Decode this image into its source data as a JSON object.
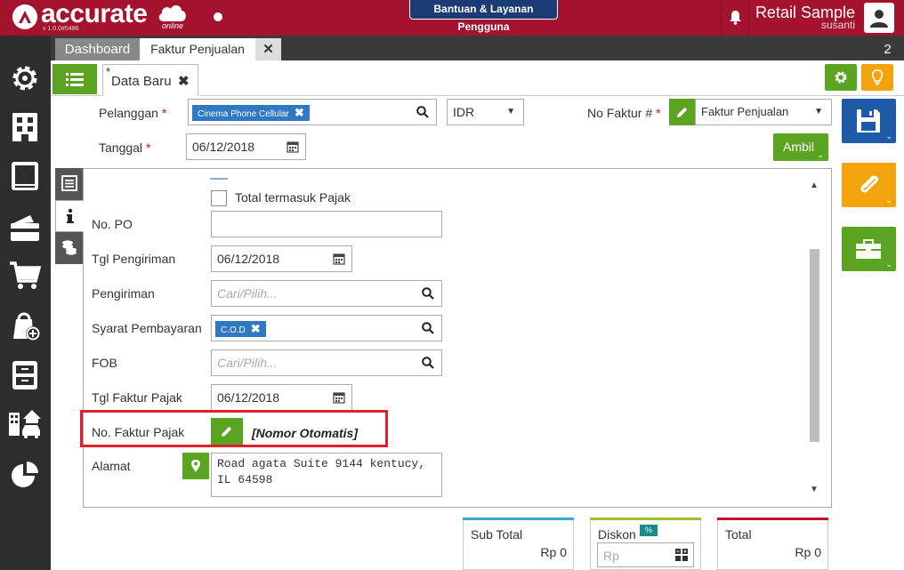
{
  "header": {
    "brand": "accurate",
    "brand_sub": "online",
    "version": "v 1.0.0#5486",
    "help_label": "Bantuan & Layanan Pengguna",
    "company": "Retail Sample",
    "user": "susanti",
    "brand_color": "#a4122e"
  },
  "rail": {
    "icons": [
      "gear-icon",
      "building-icon",
      "ledger-icon",
      "wallet-icon",
      "cart-icon",
      "shopping-bag-plus-icon",
      "filing-cabinet-icon",
      "city-car-icon",
      "pie-chart-icon"
    ]
  },
  "tabs": {
    "dashboard": "Dashboard",
    "faktur": "Faktur Penjualan",
    "close": "✕",
    "count": "2"
  },
  "subtab": {
    "star": "*",
    "label": "Data Baru",
    "close": "✖"
  },
  "form": {
    "pelanggan_label": "Pelanggan",
    "pelanggan_value": "Cinema Phone Cellular",
    "currency": "IDR",
    "no_faktur_label": "No Faktur #",
    "no_faktur_value": "Faktur Penjualan",
    "tanggal_label": "Tanggal",
    "tanggal_value": "06/12/2018",
    "required_mark": "*",
    "ambil_label": "Ambil",
    "chip_close": "✖",
    "caret": "▼",
    "dropdown_caret": "⌄"
  },
  "detail": {
    "total_pajak_label": "Total termasuk Pajak",
    "po_label": "No. PO",
    "po_value": "",
    "tgl_pengiriman_label": "Tgl Pengiriman",
    "tgl_pengiriman_value": "06/12/2018",
    "pengiriman_label": "Pengiriman",
    "pengiriman_placeholder": "Cari/Pilih...",
    "syarat_label": "Syarat Pembayaran",
    "syarat_value": "C.O.D",
    "fob_label": "FOB",
    "fob_placeholder": "Cari/Pilih...",
    "tgl_faktur_pajak_label": "Tgl Faktur Pajak",
    "tgl_faktur_pajak_value": "06/12/2018",
    "no_faktur_pajak_label": "No. Faktur Pajak",
    "no_faktur_pajak_value": "[Nomor Otomatis]",
    "alamat_label": "Alamat",
    "alamat_value": "Road agata Suite 9144 kentucy,\nIL 64598",
    "scroll_up": "▲",
    "scroll_down": "▼"
  },
  "totals": {
    "sub_total_label": "Sub Total",
    "sub_total_value": "Rp 0",
    "diskon_label": "Diskon",
    "diskon_pct": "%",
    "diskon_placeholder": "Rp",
    "total_label": "Total",
    "total_value": "Rp 0"
  },
  "colors": {
    "green": "#5aa421",
    "orange": "#f3a40d",
    "blue": "#1d5aa8",
    "highlight": "#e0202e"
  }
}
